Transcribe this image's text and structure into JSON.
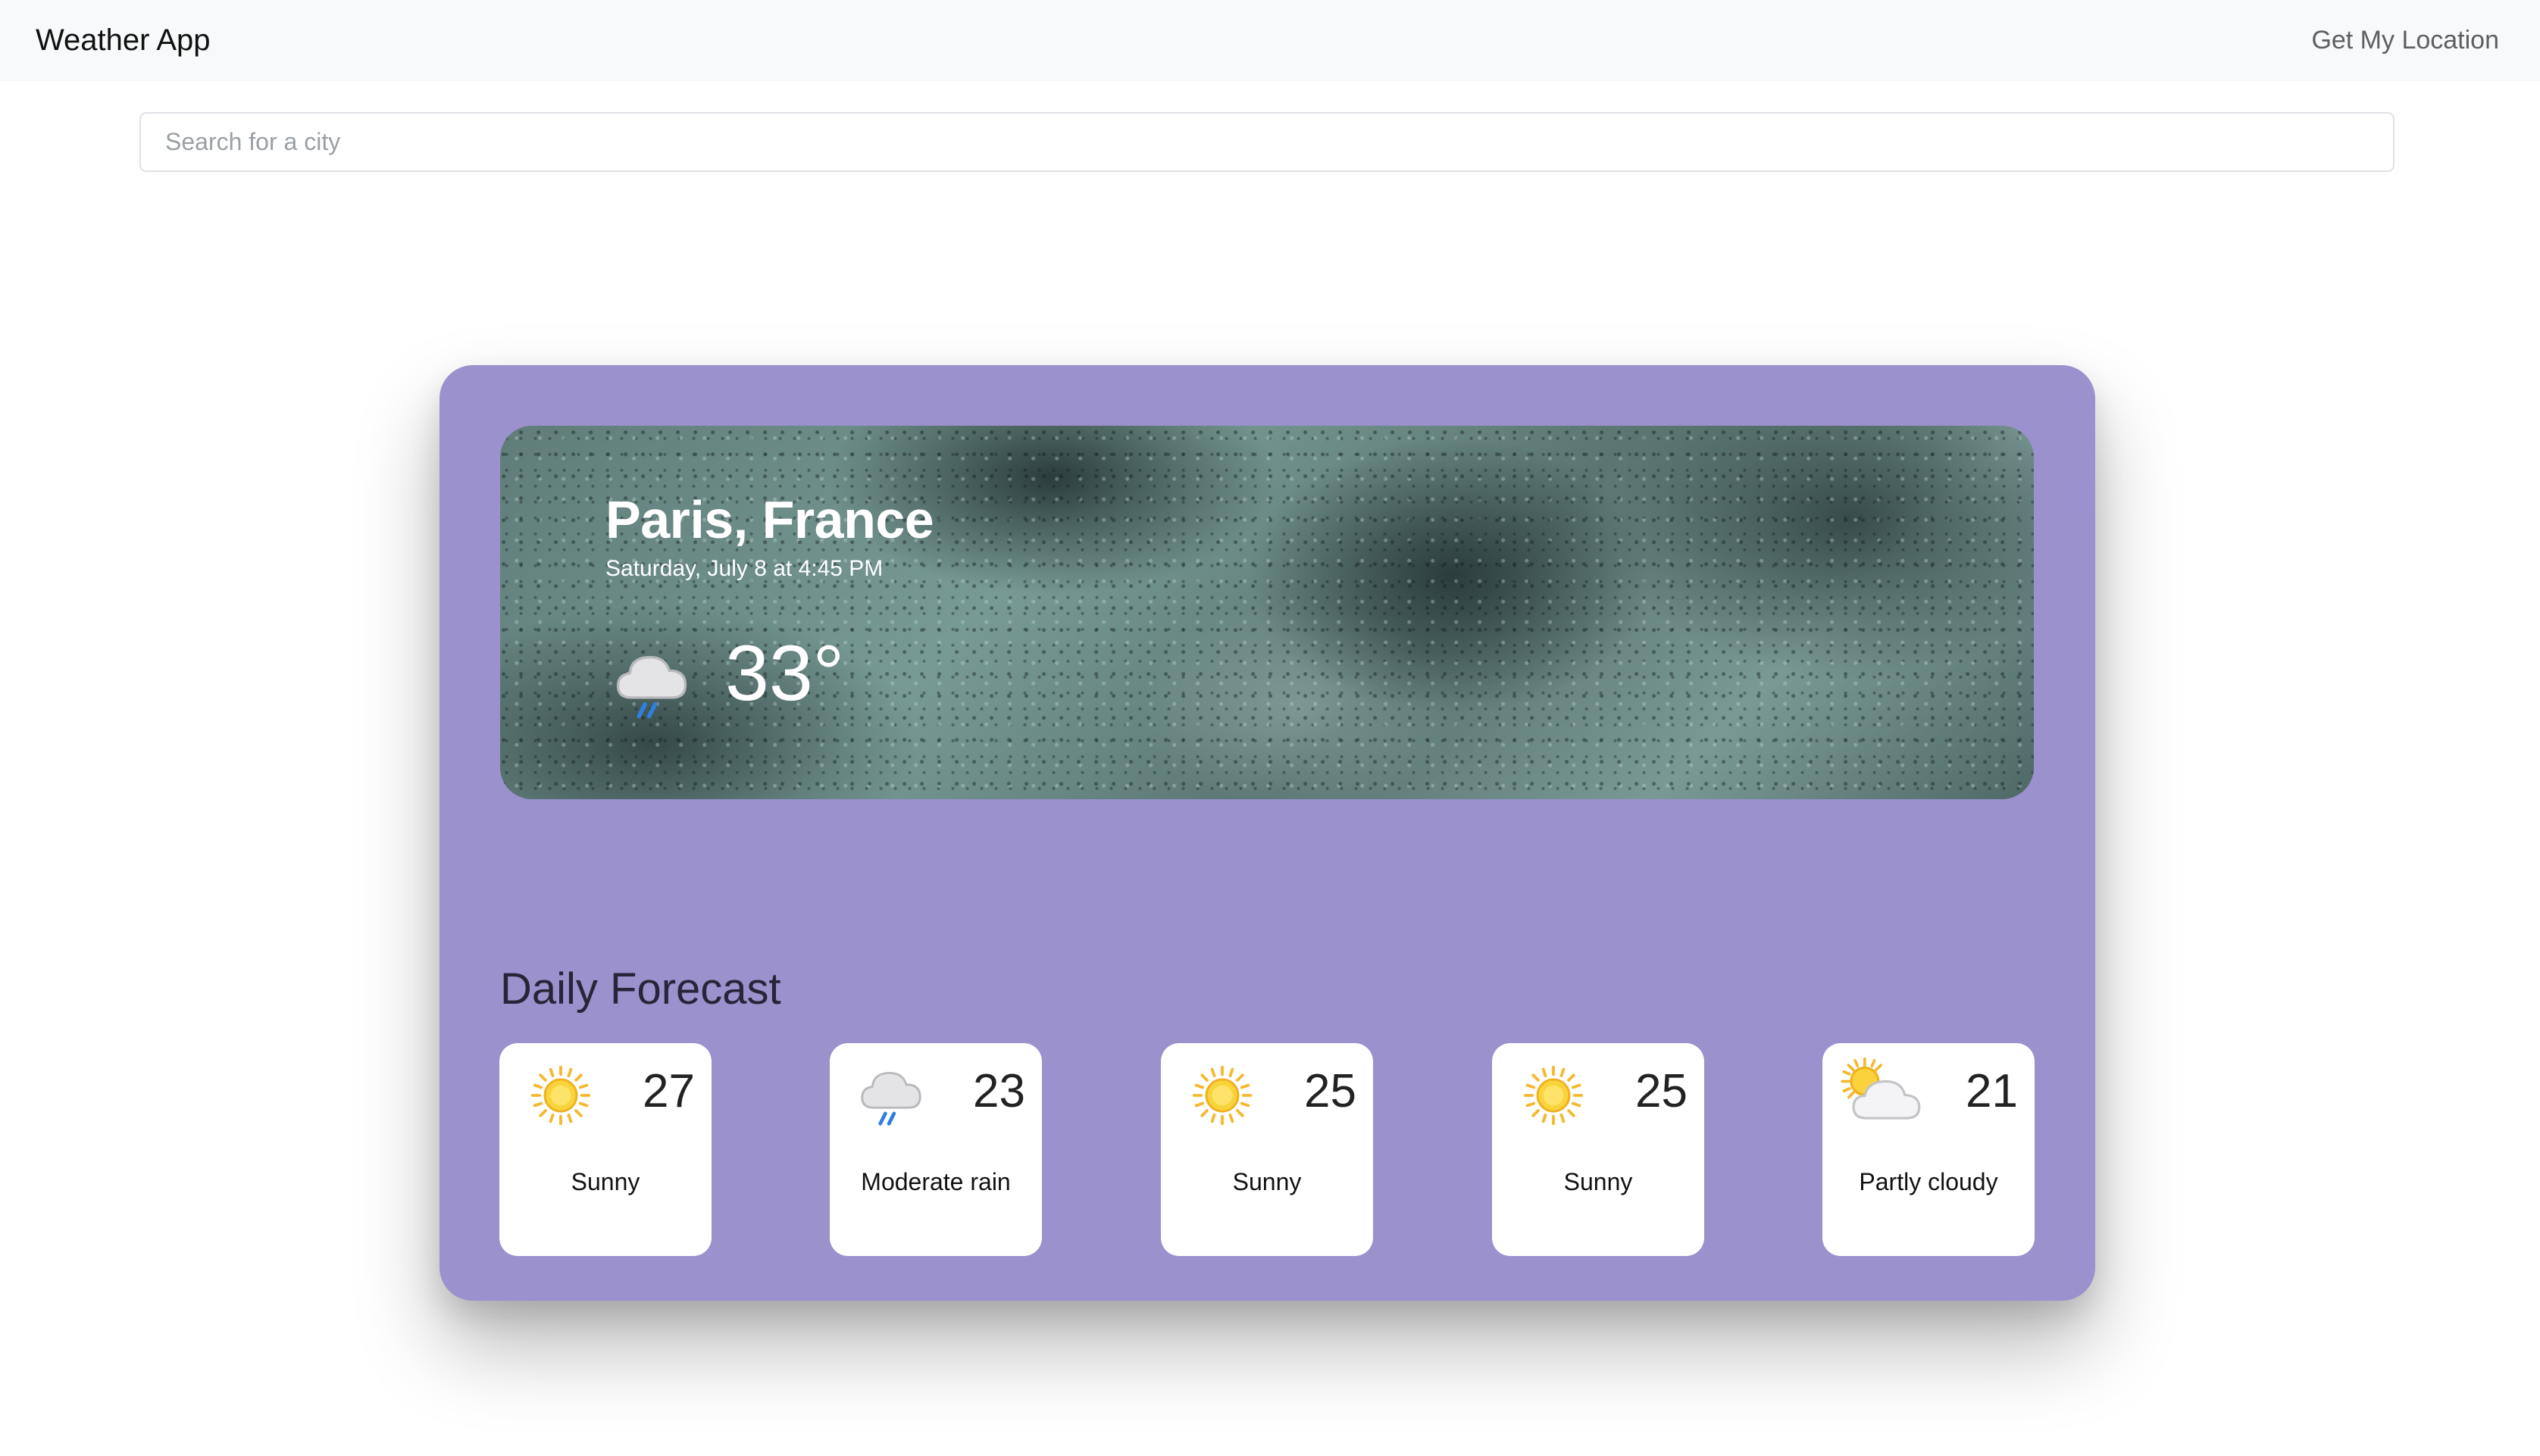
{
  "navbar": {
    "brand": "Weather App",
    "location_link": "Get My Location"
  },
  "search": {
    "value": "",
    "placeholder": "Search for a city"
  },
  "current": {
    "city": "Paris, France",
    "datetime": "Saturday, July 8 at 4:45 PM",
    "temperature": "33°",
    "icon": "rain-cloud-icon"
  },
  "forecast": {
    "title": "Daily Forecast",
    "days": [
      {
        "temp": "27",
        "condition": "Sunny",
        "icon": "sun-icon"
      },
      {
        "temp": "23",
        "condition": "Moderate rain",
        "icon": "rain-cloud-icon"
      },
      {
        "temp": "25",
        "condition": "Sunny",
        "icon": "sun-icon"
      },
      {
        "temp": "25",
        "condition": "Sunny",
        "icon": "sun-icon"
      },
      {
        "temp": "21",
        "condition": "Partly cloudy",
        "icon": "partly-cloudy-icon"
      }
    ]
  },
  "colors": {
    "card_background": "#9a91cd",
    "navbar_background": "#f8f9fa",
    "sun": "#f7c21b",
    "rain": "#2f7fe0"
  }
}
